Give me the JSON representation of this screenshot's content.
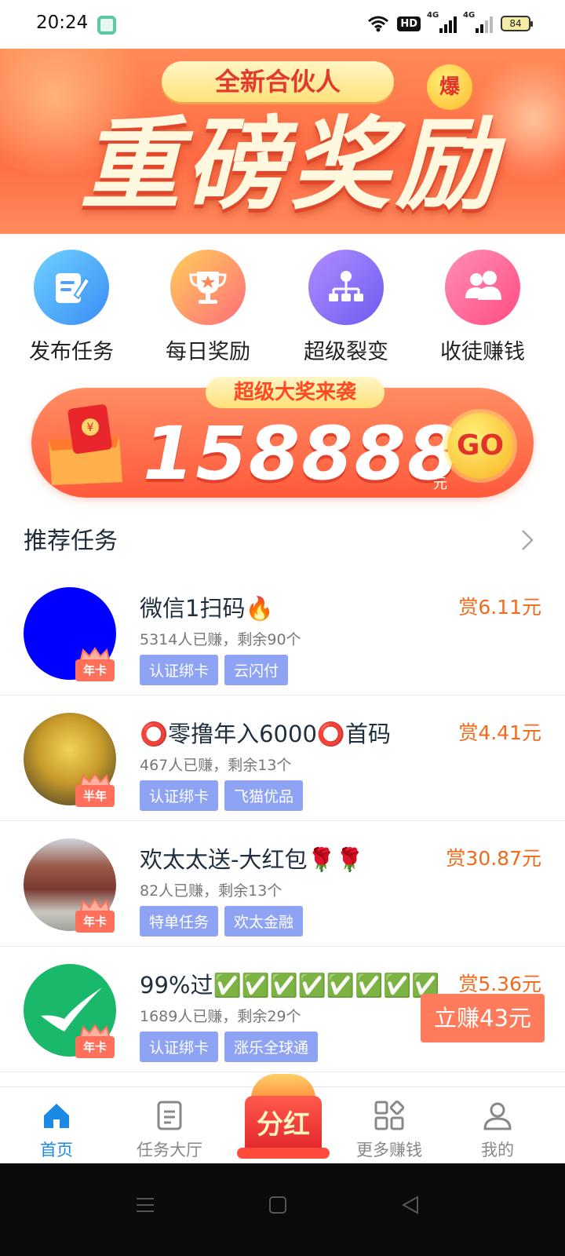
{
  "status_bar": {
    "time": "20:24",
    "hd_label": "HD",
    "network_1": "4G",
    "network_2": "4G",
    "battery": "84",
    "icons": [
      "app-icon",
      "wifi-icon",
      "hd-icon",
      "signal-icon",
      "signal-icon",
      "battery-icon"
    ]
  },
  "banner": {
    "pill": "全新合伙人",
    "hot_badge": "爆",
    "headline": "重磅奖励",
    "dots_total": 3,
    "dots_active": 3,
    "colors": {
      "primary": "#ff6b44",
      "headline": "#fff8df"
    }
  },
  "quick_actions": [
    {
      "label": "发布任务",
      "icon": "edit-icon"
    },
    {
      "label": "每日奖励",
      "icon": "trophy-icon"
    },
    {
      "label": "超级裂变",
      "icon": "network-icon"
    },
    {
      "label": "收徒赚钱",
      "icon": "users-icon"
    }
  ],
  "jackpot": {
    "tag": "超级大奖来袭",
    "amount": "158888",
    "unit": "元",
    "go_label": "GO"
  },
  "section": {
    "title": "推荐任务"
  },
  "tasks": [
    {
      "title": "微信1扫码🔥",
      "reward": "赏6.11元",
      "sub": "5314人已赚，剩余90个",
      "tags": [
        "认证绑卡",
        "云闪付"
      ],
      "badge": "年卡",
      "avatar": "blue-circle-avatar"
    },
    {
      "title": "⭕零撸年入6000⭕首码",
      "reward": "赏4.41元",
      "sub": "467人已赚，剩余13个",
      "tags": [
        "认证绑卡",
        "飞猫优品"
      ],
      "badge": "半年",
      "avatar": "golden-monkey-avatar"
    },
    {
      "title": "欢太太送-大红包🌹🌹",
      "reward": "赏30.87元",
      "sub": "82人已赚，剩余13个",
      "tags": [
        "特单任务",
        "欢太金融"
      ],
      "badge": "年卡",
      "avatar": "building-photo-avatar"
    },
    {
      "title": "99%过✅✅✅✅✅✅✅✅",
      "reward": "赏5.36元",
      "sub": "1689人已赚，剩余29个",
      "tags": [
        "认证绑卡",
        "涨乐全球通"
      ],
      "badge": "年卡",
      "avatar": "green-check-avatar"
    }
  ],
  "floating_button": "立赚43元",
  "bottom_nav": {
    "items": [
      {
        "label": "首页",
        "icon": "home-icon",
        "active": true
      },
      {
        "label": "任务大厅",
        "icon": "document-icon",
        "active": false
      },
      {
        "label": "更多赚钱",
        "icon": "grid-icon",
        "active": false
      },
      {
        "label": "我的",
        "icon": "person-icon",
        "active": false
      }
    ],
    "center": "分红",
    "active_color": "#1a8ae6"
  }
}
